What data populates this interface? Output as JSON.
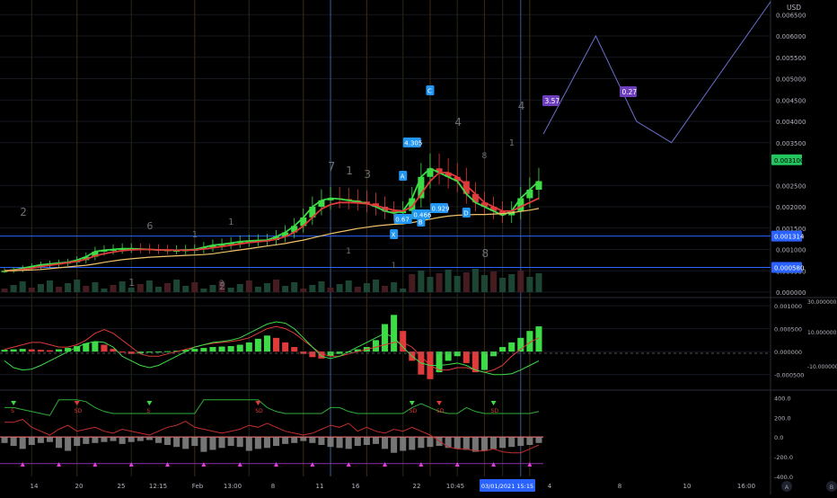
{
  "chart_data": [
    {
      "type": "line",
      "pane": "price",
      "currency": "USD",
      "ylim": [
        0.0,
        0.0068
      ],
      "y_ticks": [
        "0.006500",
        "0.006000",
        "0.005500",
        "0.005000",
        "0.004500",
        "0.004000",
        "0.003500",
        "0.002500",
        "0.002000",
        "0.001500",
        "0.001000",
        "0.000500",
        "0.000000"
      ],
      "price_tag": {
        "label": "0.003100",
        "value": 0.0031,
        "color": "#22c55e"
      },
      "level_tags": [
        {
          "label": "0.001314",
          "value": 0.001314,
          "color": "#2962ff"
        },
        {
          "label": "0.000580",
          "value": 0.00058,
          "color": "#2962ff"
        }
      ],
      "series": [
        {
          "color": "#3ddc47",
          "values": [
            0.0005,
            0.00052,
            0.00056,
            0.0006,
            0.00064,
            0.00066,
            0.00068,
            0.0007,
            0.00075,
            0.00083,
            0.00095,
            0.00098,
            0.001,
            0.00102,
            0.00102,
            0.00101,
            0.001,
            0.00099,
            0.00098,
            0.00098,
            0.00099,
            0.001,
            0.00105,
            0.0011,
            0.00112,
            0.00115,
            0.00118,
            0.0012,
            0.00121,
            0.00122,
            0.0013,
            0.0014,
            0.00155,
            0.00175,
            0.002,
            0.00215,
            0.0022,
            0.00218,
            0.00215,
            0.00212,
            0.00208,
            0.002,
            0.0019,
            0.00185,
            0.0019,
            0.0022,
            0.0027,
            0.0029,
            0.0028,
            0.0027,
            0.0026,
            0.0023,
            0.0021,
            0.002,
            0.0019,
            0.0018,
            0.0019,
            0.0022,
            0.0024,
            0.0026
          ]
        },
        {
          "color": "#e03a3a",
          "values": [
            0.0005,
            0.00051,
            0.00053,
            0.00056,
            0.0006,
            0.00063,
            0.00066,
            0.00069,
            0.00072,
            0.00077,
            0.00085,
            0.0009,
            0.00094,
            0.00097,
            0.00099,
            0.001,
            0.001,
            0.00099,
            0.00099,
            0.00098,
            0.00098,
            0.00099,
            0.00101,
            0.00104,
            0.00107,
            0.0011,
            0.00113,
            0.00116,
            0.00118,
            0.0012,
            0.00124,
            0.0013,
            0.0014,
            0.00155,
            0.00175,
            0.00195,
            0.00205,
            0.0021,
            0.0021,
            0.00209,
            0.00207,
            0.00203,
            0.00197,
            0.00192,
            0.0019,
            0.002,
            0.0023,
            0.0026,
            0.0028,
            0.0028,
            0.0027,
            0.0025,
            0.0023,
            0.0021,
            0.002,
            0.0019,
            0.0019,
            0.002,
            0.0021,
            0.0022
          ]
        },
        {
          "color": "#f0c36a",
          "values": [
            0.0005,
            0.000505,
            0.00051,
            0.00052,
            0.00053,
            0.00055,
            0.00057,
            0.00059,
            0.00061,
            0.00063,
            0.00066,
            0.0007,
            0.00073,
            0.00076,
            0.00078,
            0.0008,
            0.00082,
            0.00083,
            0.00084,
            0.00085,
            0.00086,
            0.00087,
            0.00088,
            0.0009,
            0.00093,
            0.00096,
            0.00099,
            0.00102,
            0.00105,
            0.00108,
            0.00111,
            0.00114,
            0.00118,
            0.00122,
            0.00127,
            0.00132,
            0.00137,
            0.00141,
            0.00145,
            0.00149,
            0.00152,
            0.00155,
            0.00157,
            0.00159,
            0.0016,
            0.00163,
            0.00167,
            0.00171,
            0.00175,
            0.00178,
            0.0018,
            0.00181,
            0.00182,
            0.00182,
            0.00183,
            0.00184,
            0.00186,
            0.00189,
            0.00192,
            0.00196
          ]
        }
      ],
      "projection": {
        "color": "#6a6fd0",
        "points": [
          [
            0.00325,
            0.0037
          ],
          [
            0.0037,
            0.006
          ],
          [
            0.00405,
            0.004
          ],
          [
            0.00435,
            0.0035
          ],
          [
            0.0052,
            0.0068
          ]
        ]
      },
      "wave_labels": [
        "2",
        "6",
        "1",
        "1",
        "7",
        "1",
        "3",
        "1",
        "2",
        "4",
        "8",
        "4",
        "1",
        "1",
        "1",
        "8",
        "1",
        "2"
      ],
      "markers": [
        "C",
        "A",
        "4.305",
        "0.67",
        "X",
        "B",
        "0.466",
        "0.929",
        "D",
        "8"
      ],
      "fib_badges": [
        {
          "label": "3.57",
          "color": "#6d3fbf"
        },
        {
          "label": "0.27",
          "color": "#6d3fbf"
        }
      ]
    },
    {
      "type": "bar",
      "pane": "macd",
      "ylim": [
        -0.0008,
        0.0011
      ],
      "y_ticks": [
        "0.001000",
        "0.000500",
        "0.000000",
        "-0.000500"
      ],
      "right_ticks": [
        "30.000000",
        "10.000000",
        "-10.000000"
      ],
      "values": [
        4e-05,
        5e-05,
        6e-05,
        5e-05,
        4e-05,
        3e-05,
        5e-05,
        8e-05,
        0.00012,
        0.00018,
        0.00022,
        0.00015,
        6e-05,
        -2e-05,
        -5e-05,
        -4e-05,
        -2e-05,
        0.0,
        1e-05,
        2e-05,
        4e-05,
        6e-05,
        8e-05,
        0.0001,
        0.00011,
        0.00012,
        0.00015,
        0.0002,
        0.00028,
        0.00035,
        0.0003,
        0.0002,
        0.0001,
        -5e-05,
        -0.00012,
        -0.00015,
        -0.0001,
        -5e-05,
        0.0,
        5e-05,
        0.0001,
        0.00025,
        0.0006,
        0.0008,
        0.00045,
        -0.0002,
        -0.0005,
        -0.0006,
        -0.00045,
        -0.0002,
        -0.0001,
        -0.00025,
        -0.00045,
        -0.0004,
        -0.0001,
        0.0001,
        0.0002,
        0.0003,
        0.00045,
        0.00055
      ],
      "series": [
        {
          "color": "#e03a3a",
          "values": [
            5e-05,
            0.0001,
            0.00015,
            0.0002,
            0.0002,
            0.00015,
            0.0001,
            0.0001,
            0.00015,
            0.00025,
            0.0004,
            0.00048,
            0.0004,
            0.00025,
            0.0001,
            -5e-05,
            -0.0001,
            -0.0001,
            -5e-05,
            0.0,
            5e-05,
            0.0001,
            0.00015,
            0.00018,
            0.0002,
            0.00022,
            0.00025,
            0.0003,
            0.0004,
            0.0005,
            0.00055,
            0.0005,
            0.0004,
            0.00025,
            0.0001,
            -5e-05,
            -0.0001,
            -0.0001,
            -5e-05,
            0.0,
            5e-05,
            0.0001,
            0.00015,
            0.0002,
            0.0002,
            0.0001,
            -0.0001,
            -0.0003,
            -0.0004,
            -0.0004,
            -0.00035,
            -0.00035,
            -0.0004,
            -0.00045,
            -0.0004,
            -0.0003,
            -0.0001,
            5e-05,
            0.0002,
            0.0003
          ]
        },
        {
          "color": "#3ddc47",
          "values": [
            -0.0002,
            -0.00035,
            -0.0004,
            -0.00038,
            -0.0003,
            -0.0002,
            -0.0001,
            0.0,
            0.0001,
            0.00018,
            0.00022,
            0.0002,
            0.0001,
            -0.0001,
            -0.0002,
            -0.0003,
            -0.00035,
            -0.0003,
            -0.0002,
            -0.0001,
            0.0,
            0.0001,
            0.00015,
            0.0002,
            0.00022,
            0.00025,
            0.0003,
            0.0004,
            0.0005,
            0.0006,
            0.00065,
            0.00062,
            0.0005,
            0.0003,
            0.0001,
            -0.0001,
            -0.00015,
            -0.0001,
            0.0,
            0.0001,
            0.0002,
            0.0003,
            0.0004,
            0.0003,
            0.0001,
            -0.0001,
            -0.00025,
            -0.0003,
            -0.0003,
            -0.00028,
            -0.00025,
            -0.0003,
            -0.0004,
            -0.00045,
            -0.0005,
            -0.0005,
            -0.00048,
            -0.0004,
            -0.0003,
            -0.0002
          ]
        }
      ]
    },
    {
      "type": "line",
      "pane": "oscillator",
      "ylim": [
        -400,
        450
      ],
      "y_ticks": [
        "400.0",
        "200.0",
        "0.0",
        "-200.0",
        "-400.0"
      ],
      "series": [
        {
          "color": "#2fae3a",
          "values": [
            300,
            300,
            280,
            260,
            240,
            220,
            380,
            380,
            380,
            360,
            300,
            260,
            240,
            240,
            240,
            240,
            240,
            240,
            240,
            240,
            240,
            240,
            380,
            380,
            380,
            380,
            380,
            380,
            380,
            300,
            260,
            240,
            240,
            240,
            240,
            240,
            300,
            300,
            260,
            240,
            240,
            240,
            240,
            240,
            240,
            300,
            340,
            300,
            260,
            240,
            240,
            300,
            260,
            240,
            240,
            240,
            240,
            240,
            240,
            260
          ]
        },
        {
          "color": "#c22f2f",
          "values": [
            150,
            150,
            180,
            100,
            60,
            20,
            80,
            120,
            60,
            80,
            100,
            60,
            40,
            80,
            60,
            40,
            20,
            60,
            100,
            120,
            160,
            100,
            80,
            60,
            40,
            60,
            80,
            120,
            100,
            140,
            100,
            60,
            40,
            20,
            40,
            80,
            120,
            100,
            140,
            60,
            100,
            60,
            40,
            80,
            60,
            100,
            60,
            20,
            -40,
            -100,
            -120,
            -120,
            -140,
            -140,
            -120,
            -150,
            -160,
            -160,
            -120,
            -80
          ]
        }
      ],
      "bars": [
        -60,
        -90,
        -120,
        -80,
        -60,
        -50,
        -110,
        -140,
        -90,
        -70,
        -60,
        -50,
        -40,
        -70,
        -50,
        -40,
        -30,
        -60,
        -80,
        -100,
        -120,
        -90,
        -150,
        -130,
        -110,
        -90,
        -100,
        -140,
        -120,
        -110,
        -90,
        -70,
        -60,
        -40,
        -60,
        -80,
        -100,
        -110,
        -120,
        -90,
        -80,
        -70,
        -120,
        -160,
        -140,
        -130,
        -110,
        -100,
        -90,
        -110,
        -120,
        -130,
        -150,
        -140,
        -120,
        -110,
        -100,
        -90,
        -80,
        -60
      ],
      "signal_labels": [
        "S",
        "SD",
        "S",
        "SD",
        "SD",
        "SD",
        "SD"
      ]
    }
  ],
  "x_axis": {
    "tick_labels": [
      "14",
      "20",
      "25",
      "12:15",
      "Feb",
      "13:00",
      "8",
      "11",
      "16",
      "22",
      "10:45",
      "4",
      "8",
      "10",
      "16:00"
    ],
    "crosshair_label": "03/01/2021  15:15"
  },
  "corner_buttons": [
    "A",
    "B"
  ]
}
